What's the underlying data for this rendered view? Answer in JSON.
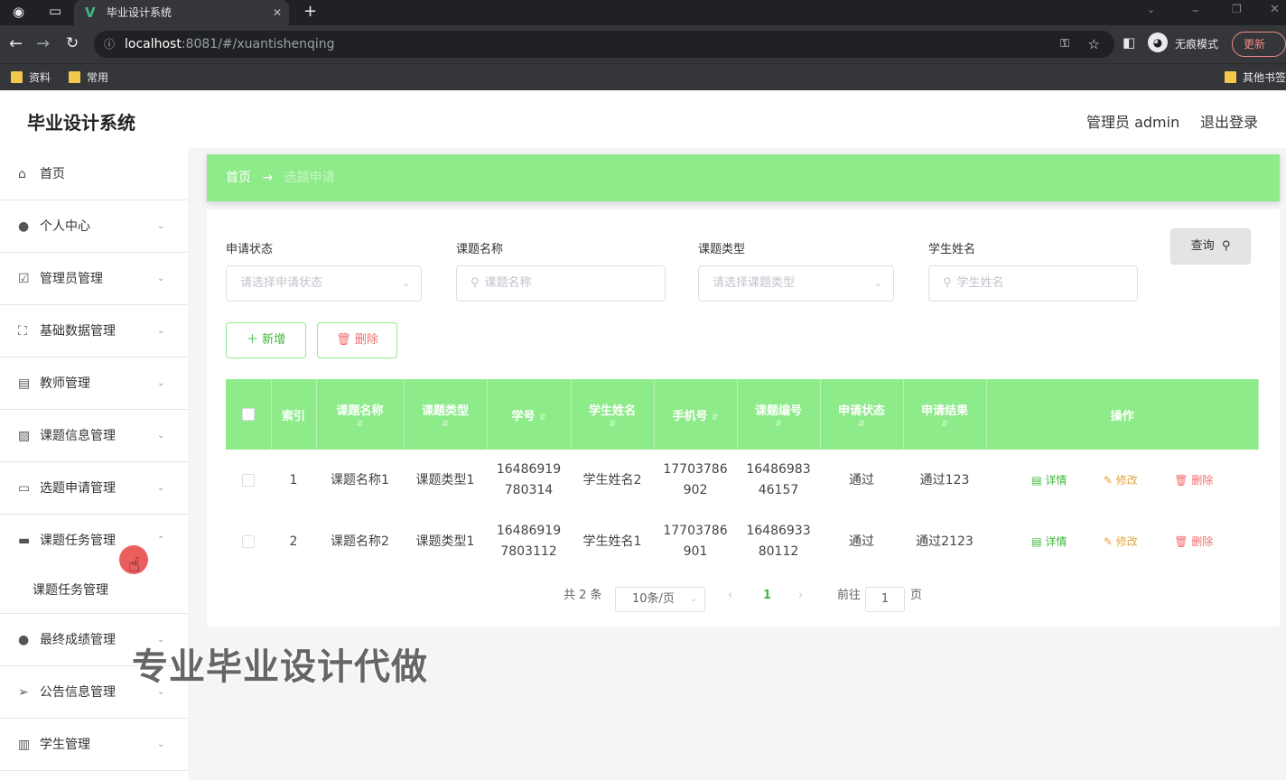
{
  "browser": {
    "tab_title": "毕业设计系统",
    "url_host": "localhost",
    "url_rest": ":8081/#/xuantishenqing",
    "incognito_label": "无痕模式",
    "update_label": "更新",
    "bookmarks": [
      "资料",
      "常用"
    ],
    "other_bookmarks": "其他书签"
  },
  "header": {
    "app_title": "毕业设计系统",
    "user": "管理员 admin",
    "logout": "退出登录"
  },
  "sidebar": {
    "items": [
      {
        "label": "首页",
        "icon": "home-icon"
      },
      {
        "label": "个人中心",
        "icon": "user-icon"
      },
      {
        "label": "管理员管理",
        "icon": "check-square-icon"
      },
      {
        "label": "基础数据管理",
        "icon": "frame-icon"
      },
      {
        "label": "教师管理",
        "icon": "id-card-icon"
      },
      {
        "label": "课题信息管理",
        "icon": "chart-icon"
      },
      {
        "label": "选题申请管理",
        "icon": "message-icon"
      },
      {
        "label": "课题任务管理",
        "icon": "monitor-icon"
      },
      {
        "label": "最终成绩管理",
        "icon": "bulb-icon"
      },
      {
        "label": "公告信息管理",
        "icon": "send-icon"
      },
      {
        "label": "学生管理",
        "icon": "books-icon"
      }
    ],
    "submenu": "课题任务管理"
  },
  "breadcrumb": {
    "home": "首页",
    "arrow": "→",
    "current": "选题申请"
  },
  "filters": {
    "status_label": "申请状态",
    "status_placeholder": "请选择申请状态",
    "name_label": "课题名称",
    "name_placeholder": "课题名称",
    "type_label": "课题类型",
    "type_placeholder": "请选择课题类型",
    "student_label": "学生姓名",
    "student_placeholder": "学生姓名",
    "query": "查询"
  },
  "actions": {
    "add": "新增",
    "delete": "删除"
  },
  "table": {
    "headers": [
      "索引",
      "课题名称",
      "课题类型",
      "学号",
      "学生姓名",
      "手机号",
      "课题编号",
      "申请状态",
      "申请结果",
      "操作"
    ],
    "rows": [
      {
        "index": "1",
        "title": "课题名称1",
        "type": "课题类型1",
        "sno_a": "16486919",
        "sno_b": "780314",
        "student": "学生姓名2",
        "phone_a": "17703786",
        "phone_b": "902",
        "code_a": "16486983",
        "code_b": "46157",
        "status": "通过",
        "result": "通过123"
      },
      {
        "index": "2",
        "title": "课题名称2",
        "type": "课题类型1",
        "sno_a": "16486919",
        "sno_b": "7803112",
        "student": "学生姓名1",
        "phone_a": "17703786",
        "phone_b": "901",
        "code_a": "16486933",
        "code_b": "80112",
        "status": "通过",
        "result": "通过2123"
      }
    ],
    "op_detail": "详情",
    "op_edit": "修改",
    "op_delete": "删除"
  },
  "pagination": {
    "total": "共 2 条",
    "page_size": "10条/页",
    "current": "1",
    "goto": "前往",
    "goto_value": "1",
    "page_unit": "页"
  },
  "watermark": "专业毕业设计代做"
}
